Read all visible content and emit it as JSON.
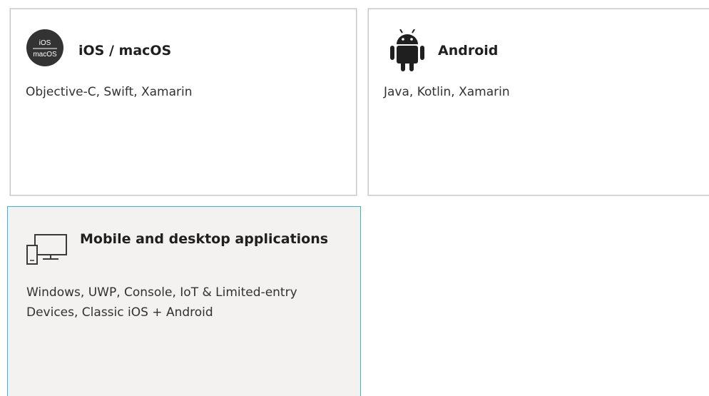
{
  "tiles": {
    "ios": {
      "title": "iOS / macOS",
      "description": "Objective-C, Swift, Xamarin",
      "icon": "ios-macos-icon",
      "icon_text_top": "iOS",
      "icon_text_bottom": "macOS"
    },
    "android": {
      "title": "Android",
      "description": "Java, Kotlin, Xamarin",
      "icon": "android-icon"
    },
    "desktop": {
      "title": "Mobile and desktop applications",
      "description": "Windows, UWP, Console, IoT & Limited-entry Devices, Classic iOS + Android",
      "icon": "desktop-device-icon",
      "selected": true
    }
  },
  "colors": {
    "selected_border": "#35b6e8",
    "selected_background": "#f3f2f1",
    "tile_border": "#c8c6c4",
    "icon_dark": "#333333"
  }
}
